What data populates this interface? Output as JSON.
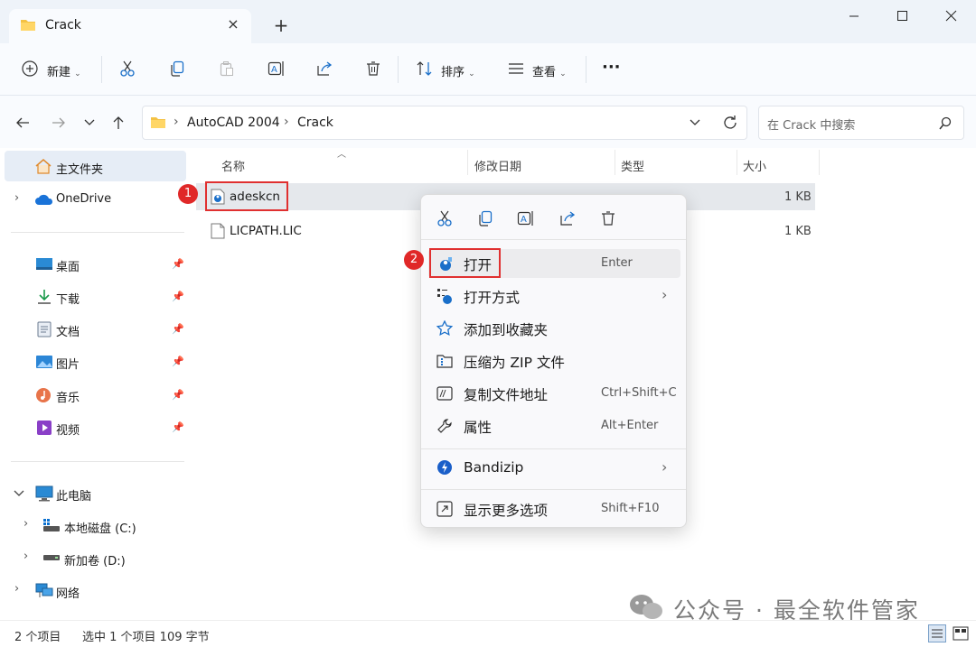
{
  "window": {
    "tab_title": "Crack",
    "tab_close": "×",
    "new_tab": "+"
  },
  "toolbar": {
    "new_label": "新建",
    "sort_label": "排序",
    "view_label": "查看",
    "more_label": "···",
    "chevron": "⌄"
  },
  "address": {
    "crumbs": [
      "AutoCAD 2004",
      "Crack"
    ],
    "separator": "›",
    "search_placeholder": "在 Crack 中搜索"
  },
  "sidebar": {
    "home": "主文件夹",
    "onedrive": "OneDrive",
    "quick": [
      {
        "label": "桌面",
        "icon": "desktop-icon"
      },
      {
        "label": "下载",
        "icon": "download-icon"
      },
      {
        "label": "文档",
        "icon": "document-icon"
      },
      {
        "label": "图片",
        "icon": "pictures-icon"
      },
      {
        "label": "音乐",
        "icon": "music-icon"
      },
      {
        "label": "视频",
        "icon": "video-icon"
      }
    ],
    "thispc": "此电脑",
    "drive_c": "本地磁盘 (C:)",
    "drive_d": "新加卷 (D:)",
    "network": "网络"
  },
  "columns": {
    "name": "名称",
    "modified": "修改日期",
    "type": "类型",
    "size": "大小"
  },
  "files": [
    {
      "name": "adeskcn",
      "size": "1 KB",
      "selected": true
    },
    {
      "name": "LICPATH.LIC",
      "size": "1 KB",
      "selected": false
    }
  ],
  "annotations": {
    "step1": "1",
    "step2": "2"
  },
  "context_menu": {
    "items": [
      {
        "label": "打开",
        "shortcut": "Enter"
      },
      {
        "label": "打开方式",
        "shortcut": ""
      },
      {
        "label": "添加到收藏夹",
        "shortcut": ""
      },
      {
        "label": "压缩为 ZIP 文件",
        "shortcut": ""
      },
      {
        "label": "复制文件地址",
        "shortcut": "Ctrl+Shift+C"
      },
      {
        "label": "属性",
        "shortcut": "Alt+Enter"
      },
      {
        "label": "Bandizip",
        "shortcut": ""
      },
      {
        "label": "显示更多选项",
        "shortcut": "Shift+F10"
      }
    ],
    "submenu_arrow": "›"
  },
  "status": {
    "count": "2 个项目",
    "selection": "选中 1 个项目  109 字节"
  },
  "watermark": "公众号 · 最全软件管家",
  "colors": {
    "accent": "#0067c0",
    "highlight_border": "#e03030",
    "badge": "#e02828",
    "folder": "#f4c244"
  }
}
